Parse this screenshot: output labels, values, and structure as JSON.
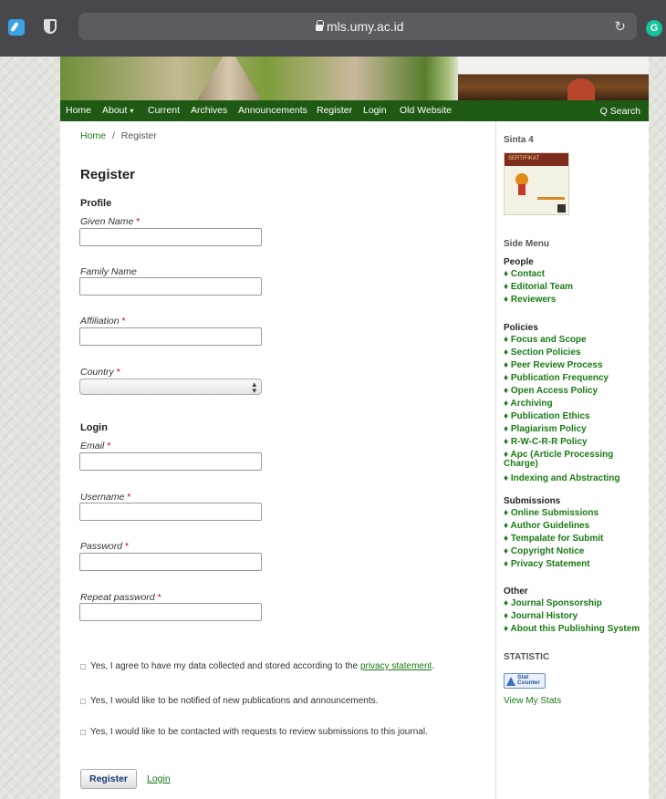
{
  "browser": {
    "url": "mls.umy.ac.id",
    "reload_icon": "↻",
    "extension_badge": "G"
  },
  "nav": {
    "items": [
      "Home",
      "About",
      "Current",
      "Archives",
      "Announcements",
      "Register",
      "Login",
      "Old Website"
    ],
    "about_caret": "▾",
    "search": "Q Search"
  },
  "breadcrumb": {
    "home": "Home",
    "sep": "/",
    "current": "Register"
  },
  "form": {
    "title": "Register",
    "profile_heading": "Profile",
    "given_name": "Given Name",
    "family_name": "Family Name",
    "affiliation": "Affiliation",
    "country": "Country",
    "country_value": "",
    "login_heading": "Login",
    "email": "Email",
    "username": "Username",
    "password": "Password",
    "repeat_password": "Repeat password",
    "required_mark": "*",
    "consent_1_prefix": "Yes, I agree to have my data collected and stored according to the ",
    "consent_1_link": "privacy statement",
    "consent_1_suffix": ".",
    "consent_2": "Yes, I would like to be notified of new publications and announcements.",
    "consent_3": "Yes, I would like to be contacted with requests to review submissions to this journal.",
    "register_button": "Register",
    "login_link": "Login"
  },
  "sidebar": {
    "sinta": "Sinta 4",
    "certificate_text": "SERTIFIKAT",
    "side_menu": "Side Menu",
    "people_heading": "People",
    "people": [
      "♦ Contact",
      "♦ Editorial Team",
      "♦ Reviewers"
    ],
    "policies_heading": "Policies",
    "policies": [
      "♦ Focus and Scope",
      "♦ Section Policies",
      "♦ Peer Review Process",
      "♦ Publication Frequency",
      "♦ Open Access Policy",
      "♦ Archiving",
      "♦ Publication Ethics",
      "♦ Plagiarism Policy",
      "♦ R-W-C-R-R Policy",
      "♦ Apc (Article Processing Charge)",
      "♦ Indexing and Abstracting"
    ],
    "submissions_heading": "Submissions",
    "submissions": [
      "♦ Online Submissions",
      "♦ Author Guidelines",
      "♦ Tempalate for Submit",
      "♦ Copyright Notice",
      "♦ Privacy Statement"
    ],
    "other_heading": "Other",
    "other": [
      "♦ Journal Sponsorship",
      "♦ Journal History",
      "♦ About this Publishing System"
    ],
    "statistic": "STATISTIC",
    "statcounter": "Stat Counter",
    "view_stats": "View My Stats"
  }
}
